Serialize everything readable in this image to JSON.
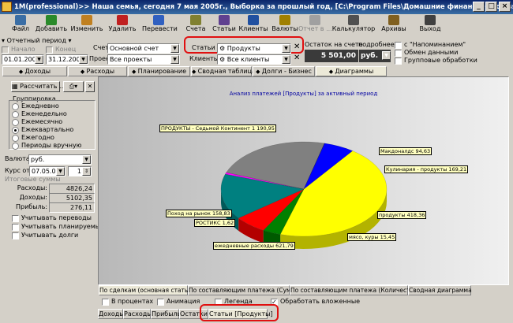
{
  "window": {
    "title": "1M(professional)>> Наша семья, сегодня 7 мая 2005г., Выборка за прошлый год, [C:\\Program Files\\Домашние финансы (professional)\\DATA\\]",
    "buttons": [
      "_",
      "□",
      "×"
    ]
  },
  "toolbar": {
    "items": [
      {
        "label": "Файл",
        "icon": "file-icon",
        "color": "#3a6ea5"
      },
      {
        "label": "Добавить",
        "icon": "add-icon",
        "color": "#2a8a2a"
      },
      {
        "label": "Изменить",
        "icon": "edit-icon",
        "color": "#c08020"
      },
      {
        "label": "Удалить",
        "icon": "delete-icon",
        "color": "#c02020"
      },
      {
        "label": "Перевести",
        "icon": "transfer-icon",
        "color": "#3060c0"
      },
      {
        "label": "Счета",
        "icon": "accounts-icon",
        "color": "#808030"
      },
      {
        "label": "Статьи",
        "icon": "articles-icon",
        "color": "#604090"
      },
      {
        "label": "Клиенты",
        "icon": "clients-icon",
        "color": "#2050a0"
      },
      {
        "label": "Валюты",
        "icon": "currency-icon",
        "color": "#a08000"
      },
      {
        "label": "Отчет в ...",
        "icon": "report-icon",
        "color": "#a0a0a0"
      },
      {
        "label": "Калькулятор",
        "icon": "calculator-icon",
        "color": "#505050"
      },
      {
        "label": "Архивы",
        "icon": "archives-icon",
        "color": "#806020"
      },
      {
        "label": "Выход",
        "icon": "exit-icon",
        "color": "#404040"
      }
    ]
  },
  "period": {
    "label": "Отчетный период",
    "start_label": "Начало",
    "end_label": "Конец",
    "start": "01.01.2004",
    "end": "31.12.2004"
  },
  "filters": {
    "account_label": "Счет",
    "account_value": "Основной счет",
    "project_label": "Проект",
    "project_value": "Все проекты",
    "articles_label": "Статьи",
    "articles_value": "Продукты",
    "clients_label": "Клиенты",
    "clients_value": "Все клиенты"
  },
  "balance": {
    "label": "Остаток на счете",
    "detail_label": "подробнее",
    "value": "5 501,00",
    "currency": "руб."
  },
  "options": {
    "reminders": "с \"Напоминанием\"",
    "exchange": "Обмен данными",
    "group_processing": "Групповые обработки"
  },
  "main_tabs": [
    {
      "label": "Доходы",
      "active": false
    },
    {
      "label": "Расходы",
      "active": false
    },
    {
      "label": "Планирование",
      "active": false
    },
    {
      "label": "Сводная таблица",
      "active": false
    },
    {
      "label": "Долги - Бизнес",
      "active": false
    },
    {
      "label": "Диаграммы",
      "active": true
    }
  ],
  "sidebar": {
    "calc_button": "Рассчитать ...",
    "grouping_title": "Группировка",
    "grouping_options": [
      {
        "label": "Ежедневно",
        "checked": false
      },
      {
        "label": "Еженедельно",
        "checked": false
      },
      {
        "label": "Ежемесячно",
        "checked": false
      },
      {
        "label": "Ежеквартально",
        "checked": true
      },
      {
        "label": "Ежегодно",
        "checked": false
      },
      {
        "label": "Периоды вручную",
        "checked": false
      }
    ],
    "currency_label": "Валюта",
    "currency_value": "руб.",
    "rate_label": "Курс от",
    "rate_date": "07.05.05",
    "rate_value": "1",
    "totals_title": "Итоговые суммы",
    "totals": [
      {
        "label": "Расходы:",
        "value": "4826,24"
      },
      {
        "label": "Доходы:",
        "value": "5102,35"
      },
      {
        "label": "Прибыль:",
        "value": "276,11"
      }
    ],
    "checkboxes": [
      "Учитывать переводы",
      "Учитывать планируемые",
      "Учитывать долги"
    ]
  },
  "chart_data": {
    "type": "pie",
    "title": "Анализ платежей [Продукты] за активный период",
    "slices": [
      {
        "label": "ПРОДУКТЫ - Седьмой Континент",
        "value": 1190.95,
        "text": "ПРОДУКТЫ - Седьмой Континент 1 190,95",
        "color": "#ffff00"
      },
      {
        "label": "Макдоналдс",
        "value": 94.63,
        "text": "Макдоналдс 94,63",
        "color": "#008000"
      },
      {
        "label": "Кулинария - продукты",
        "value": 169.21,
        "text": "Кулинария - продукты 169,21",
        "color": "#ff0000"
      },
      {
        "label": "продукты",
        "value": 418.36,
        "text": "продукты 418,36",
        "color": "#008080"
      },
      {
        "label": "мясо, куры",
        "value": 15.45,
        "text": "мясо, куры 15,45",
        "color": "#ff00ff"
      },
      {
        "label": "ежедневные расходы",
        "value": 621.79,
        "text": "ежедневные расходы 621,79",
        "color": "#808080"
      },
      {
        "label": "РОСТИКС",
        "value": 1.62,
        "text": "РОСТИКС 1,62",
        "color": "#000080"
      },
      {
        "label": "Поход на рынок",
        "value": 158.83,
        "text": "Поход на рынок 158,83",
        "color": "#0000ff"
      }
    ]
  },
  "chart_tabs": [
    {
      "label": "По сделкам (основная статья)",
      "active": true
    },
    {
      "label": "По составляющим платежа (Сумма)",
      "active": false
    },
    {
      "label": "По составляющим платежа (Количество)",
      "active": false
    },
    {
      "label": "Сводная диаграмма",
      "active": false
    }
  ],
  "chart_options": [
    {
      "label": "В процентах",
      "checked": false
    },
    {
      "label": "Анимация",
      "checked": false
    },
    {
      "label": "Легенда",
      "checked": false
    },
    {
      "label": "Обработать вложенные",
      "checked": true
    }
  ],
  "bottom_tabs": [
    {
      "label": "Доходы",
      "active": false
    },
    {
      "label": "Расходы",
      "active": false
    },
    {
      "label": "Прибыль",
      "active": false
    },
    {
      "label": "Остатки",
      "active": false
    },
    {
      "label": "Статьи [Продукты]",
      "active": true
    }
  ]
}
